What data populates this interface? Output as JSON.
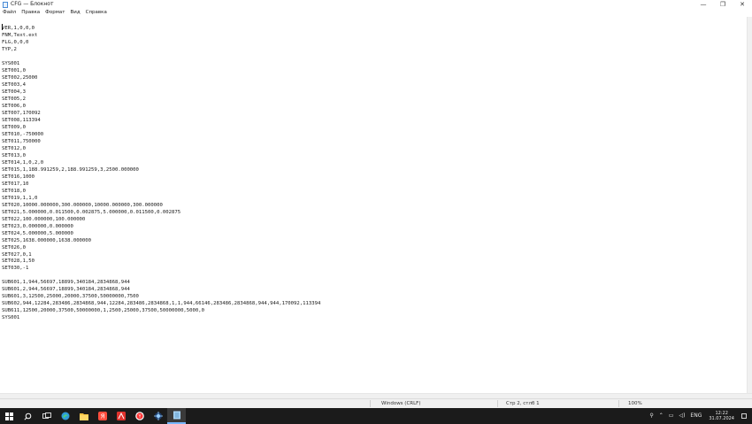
{
  "window": {
    "title": "CFG — Блокнот",
    "controls": {
      "minimize": "—",
      "maximize": "❐",
      "close": "✕"
    }
  },
  "menu": {
    "items": [
      {
        "label": "Файл"
      },
      {
        "label": "Правка"
      },
      {
        "label": "Формат"
      },
      {
        "label": "Вид"
      },
      {
        "label": "Справка"
      }
    ]
  },
  "editor": {
    "text": "VER,1,0,0,0\nFNM,Text.ext\nFLG,0,0,0\nTYP,2\n\nSYS001\nSET001,0\nSET002,25000\nSET003,4\nSET004,3\nSET005,2\nSET006,0\nSET007,170092\nSET008,113394\nSET009,0\nSET010,-750000\nSET011,750000\nSET012,0\nSET013,0\nSET014,1,0,2,0\nSET015,1,188.991259,2,188.991259,3,2500.000000\nSET016,1000\nSET017,10\nSET018,0\nSET019,1,1,0\nSET020,10000.000000,300.000000,10000.000000,300.000000\nSET021,5.000000,0.011500,0.002875,5.000000,0.011500,0.002875\nSET022,100.000000,100.000000\nSET023,0.000000,0.000000\nSET024,5.000000,5.000000\nSET025,1638.000000,1638.000000\nSET026,0\nSET027,0,1\nSET028,1,50\nSET030,-1\n\nSUB601,1,944,56697,18899,340184,2834868,944\nSUB601,2,944,56697,18899,340184,2834868,944\nSUB601,3,12500,25000,20000,37500,50000000,7500\nSUB602,944,12284,283486,2834868,944,12284,283486,2834868,1,1,944,66146,283486,2834868,944,944,170092,113394\nSUB611,12500,20000,37500,50000000,1,2500,25000,37500,50000000,5000,0\nSYS001"
  },
  "status": {
    "line_ending": "Windows (CRLF)",
    "position": "Стр 2, стлб 1",
    "zoom": "100%"
  },
  "taskbar": {
    "apps": [
      {
        "name": "start-button",
        "icon": "windows-logo-icon",
        "color": "#ffffff"
      },
      {
        "name": "search-button",
        "icon": "search-icon",
        "color": "#ffffff"
      },
      {
        "name": "task-view-button",
        "icon": "task-view-icon",
        "color": "#ffffff"
      },
      {
        "name": "edge-button",
        "icon": "edge-icon",
        "color": "#2f9bd8"
      },
      {
        "name": "file-explorer-button",
        "icon": "folder-icon",
        "color": "#f6c343"
      },
      {
        "name": "yandex-music-button",
        "icon": "yandex-app-icon",
        "color": "#ff4d3d"
      },
      {
        "name": "acrobat-button",
        "icon": "acrobat-icon",
        "color": "#e0322d"
      },
      {
        "name": "yandex-browser-button",
        "icon": "yandex-browser-icon",
        "color": "#ff3333"
      },
      {
        "name": "app-button",
        "icon": "gear-app-icon",
        "color": "#9ad0ff"
      },
      {
        "name": "notepad-button",
        "icon": "notepad-icon",
        "color": "#a8d4f5"
      }
    ],
    "tray": {
      "lang": "ENG",
      "time": "12:22",
      "date": "31.07.2024"
    }
  }
}
